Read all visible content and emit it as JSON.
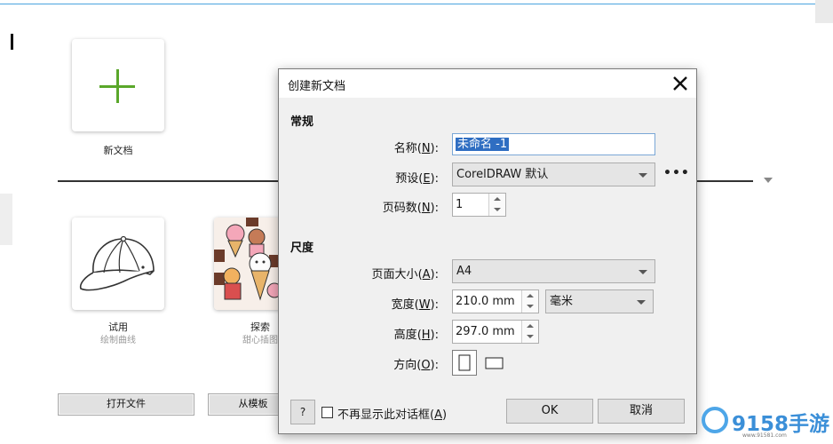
{
  "welcome": {
    "new_doc_label": "新文档",
    "templates": [
      {
        "title": "试用",
        "subtitle": "绘制曲线"
      },
      {
        "title": "探索",
        "subtitle": "甜心插图"
      }
    ],
    "open_file_label": "打开文件",
    "from_template_label": "从模板"
  },
  "dialog": {
    "title": "创建新文档",
    "general_section": "常规",
    "name_label": "名称",
    "name_hotkey": "N",
    "name_value": "未命名 -1",
    "preset_label": "预设",
    "preset_hotkey": "E",
    "preset_value": "CorelDRAW 默认",
    "more_label": "•••",
    "pages_label": "页码数",
    "pages_hotkey": "N",
    "pages_value": "1",
    "dimension_section": "尺度",
    "page_size_label": "页面大小",
    "page_size_hotkey": "A",
    "page_size_value": "A4",
    "width_label": "宽度",
    "width_hotkey": "W",
    "width_value": "210.0 mm",
    "unit_value": "毫米",
    "height_label": "高度",
    "height_hotkey": "H",
    "height_value": "297.0 mm",
    "orientation_label": "方向",
    "orientation_hotkey": "O",
    "help_label": "?",
    "dont_show_label": "不再显示此对话框",
    "dont_show_hotkey": "A",
    "ok_label": "OK",
    "cancel_label": "取消"
  },
  "watermark": {
    "brand": "9158手游",
    "url": "www.91581.com"
  },
  "colors": {
    "accent_green": "#5aa72a",
    "selection_blue": "#2f6ec2",
    "watermark_blue": "#3b8fd8"
  }
}
